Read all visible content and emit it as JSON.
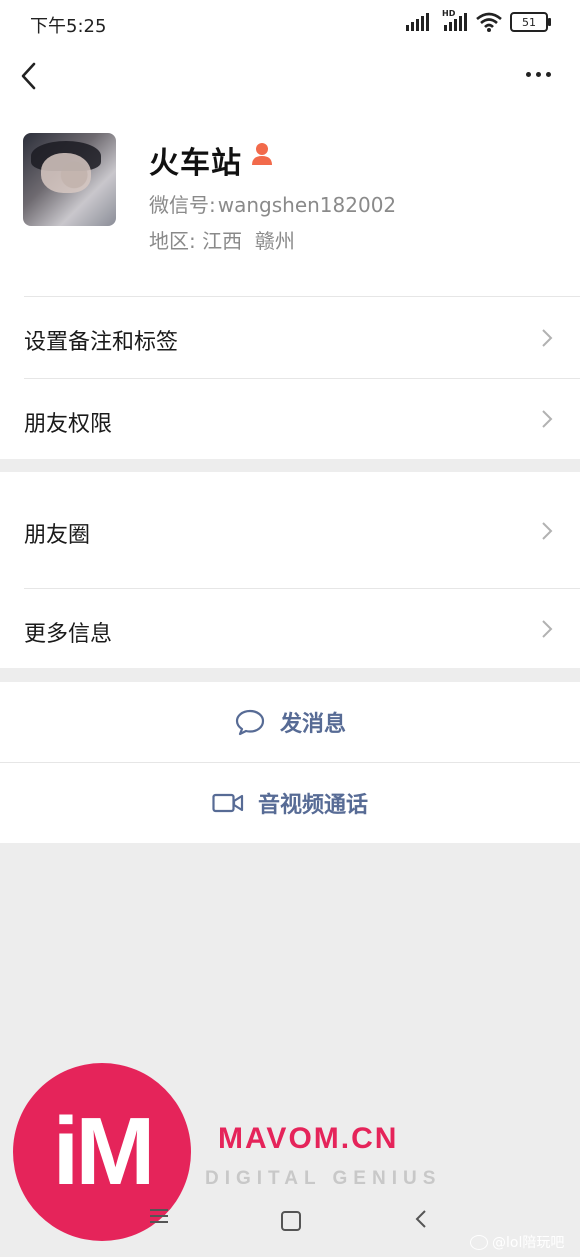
{
  "status_bar": {
    "time": "下午5:25",
    "battery": "51",
    "network_label": "HD"
  },
  "profile": {
    "nickname": "火车站",
    "wechat_id_label": "微信号:",
    "wechat_id": "wangshen182002",
    "region_label": "地区:",
    "region": "江西  赣州"
  },
  "menu_section_1": [
    {
      "label": "设置备注和标签"
    },
    {
      "label": "朋友权限"
    }
  ],
  "menu_section_2": [
    {
      "label": "朋友圈"
    },
    {
      "label": "更多信息"
    }
  ],
  "actions": {
    "message": "发消息",
    "video_call": "音视频通话"
  },
  "watermark": {
    "logo_text": "iM",
    "brand": "MAVOM.CN",
    "tagline": "DIGITAL GENIUS",
    "weibo": "@lol陪玩吧"
  },
  "colors": {
    "link_blue": "#576b95",
    "brand_red": "#e5245a",
    "gender_icon": "#f26a4b"
  }
}
